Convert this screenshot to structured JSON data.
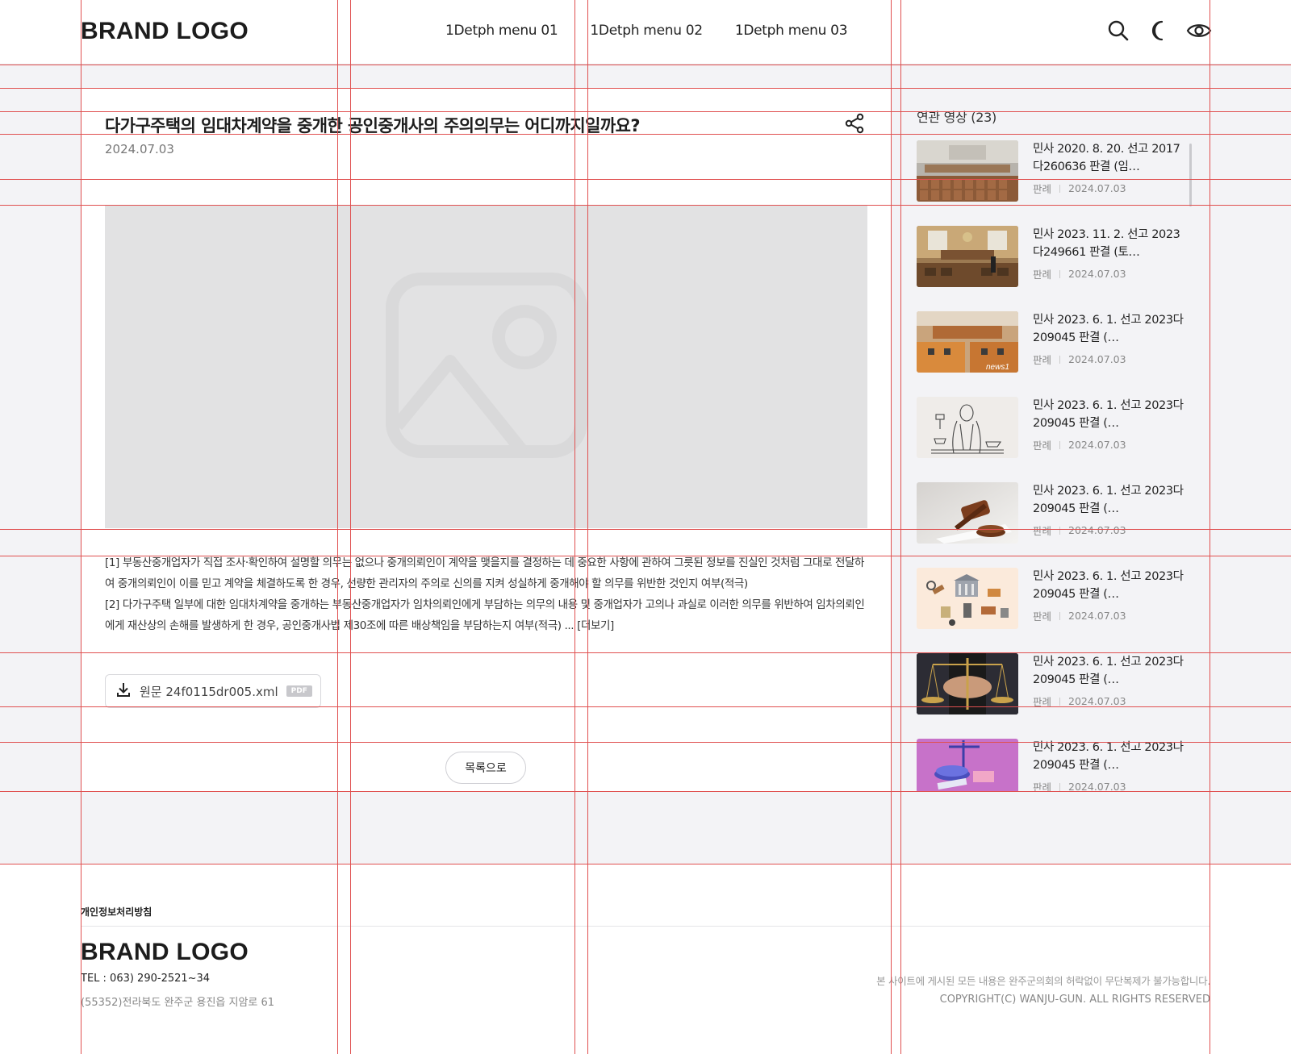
{
  "header": {
    "brand": "BRAND LOGO",
    "nav": [
      "1Detph menu 01",
      "1Detph menu 02",
      "1Detph menu 03"
    ],
    "icons": [
      "search-icon",
      "dark-mode-icon",
      "eye-icon"
    ]
  },
  "article": {
    "title": "다가구주택의 임대차계약을 중개한 공인중개사의 주의의무는 어디까지일까요?",
    "date": "2024.07.03",
    "paragraph1": "[1] 부동산중개업자가 직접 조사·확인하여 설명할 의무는 없으나 중개의뢰인이 계약을 맺을지를 결정하는 데 중요한 사항에 관하여 그릇된 정보를 진실인 것처럼 그대로 전달하여 중개의뢰인이 이를 믿고 계약을 체결하도록 한 경우, 선량한 관리자의 주의로 신의를 지켜 성실하게 중개해야 할 의무를 위반한 것인지 여부(적극)",
    "paragraph2": "[2] 다가구주택 일부에 대한 임대차계약을 중개하는 부동산중개업자가 임차의뢰인에게 부담하는 의무의 내용 및 중개업자가 고의나 과실로 이러한 의무를 위반하여 임차의뢰인에게 재산상의 손해를 발생하게 한 경우, 공인중개사법 제30조에 따른 배상책임을 부담하는지 여부(적극) ... ",
    "more": "[더보기]",
    "file_name": "원문 24f0115dr005.xml",
    "file_badge": "PDF",
    "list_button": "목록으로"
  },
  "sidebar": {
    "title": "연관 영상 (23)",
    "items": [
      {
        "title": "민사 2020. 8. 20. 선고 2017다260636 판결 (임…",
        "category": "판례",
        "date": "2024.07.03",
        "thumb": "courtroom-1"
      },
      {
        "title": "민사 2023. 11. 2. 선고 2023다249661 판결 (토…",
        "category": "판례",
        "date": "2024.07.03",
        "thumb": "courtroom-2"
      },
      {
        "title": "민사 2023. 6. 1. 선고 2023다209045 판결 (…",
        "category": "판례",
        "date": "2024.07.03",
        "thumb": "courtroom-3"
      },
      {
        "title": "민사 2023. 6. 1. 선고 2023다209045 판결 (…",
        "category": "판례",
        "date": "2024.07.03",
        "thumb": "judge-sketch"
      },
      {
        "title": "민사 2023. 6. 1. 선고 2023다209045 판결 (…",
        "category": "판례",
        "date": "2024.07.03",
        "thumb": "gavel"
      },
      {
        "title": "민사 2023. 6. 1. 선고 2023다209045 판결 (…",
        "category": "판례",
        "date": "2024.07.03",
        "thumb": "isometric-law"
      },
      {
        "title": "민사 2023. 6. 1. 선고 2023다209045 판결 (…",
        "category": "판례",
        "date": "2024.07.03",
        "thumb": "scales-hands"
      },
      {
        "title": "민사 2023. 6. 1. 선고 2023다209045 판결 (…",
        "category": "판례",
        "date": "2024.07.03",
        "thumb": "purple-scales"
      }
    ]
  },
  "footer": {
    "privacy": "개인정보처리방침",
    "brand": "BRAND LOGO",
    "tel": "TEL : 063) 290-2521~34",
    "address": "(55352)전라북도 완주군 용진읍 지암로 61",
    "notice": "본 사이트에 게시된 모든 내용은 완주군의회의 허락없이 무단복제가 불가능합니다.",
    "copyright": "COPYRIGHT(C) WANJU-GUN. ALL RIGHTS RESERVED"
  }
}
